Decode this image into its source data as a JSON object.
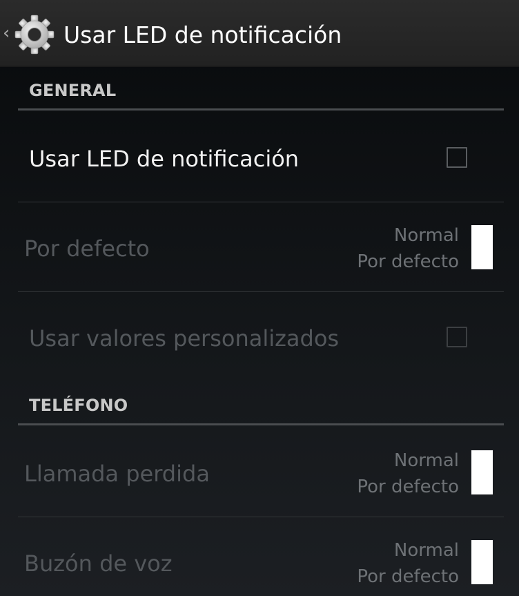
{
  "action_bar": {
    "up_caret": "‹",
    "title": "Usar LED de notificación",
    "icon": "settings-gear-icon"
  },
  "sections": {
    "general": {
      "header": "GENERAL",
      "use_led": {
        "title": "Usar LED de notificación",
        "checked": false,
        "enabled": true
      },
      "default": {
        "title": "Por defecto",
        "summary_line1": "Normal",
        "summary_line2": "Por defecto",
        "color": "#ffffff",
        "enabled": false
      },
      "custom_values": {
        "title": "Usar valores personalizados",
        "checked": false,
        "enabled": false
      }
    },
    "phone": {
      "header": "TELÉFONO",
      "missed_call": {
        "title": "Llamada perdida",
        "summary_line1": "Normal",
        "summary_line2": "Por defecto",
        "color": "#ffffff",
        "enabled": false
      },
      "voicemail": {
        "title": "Buzón de voz",
        "summary_line1": "Normal",
        "summary_line2": "Por defecto",
        "color": "#ffffff",
        "enabled": false
      }
    }
  }
}
